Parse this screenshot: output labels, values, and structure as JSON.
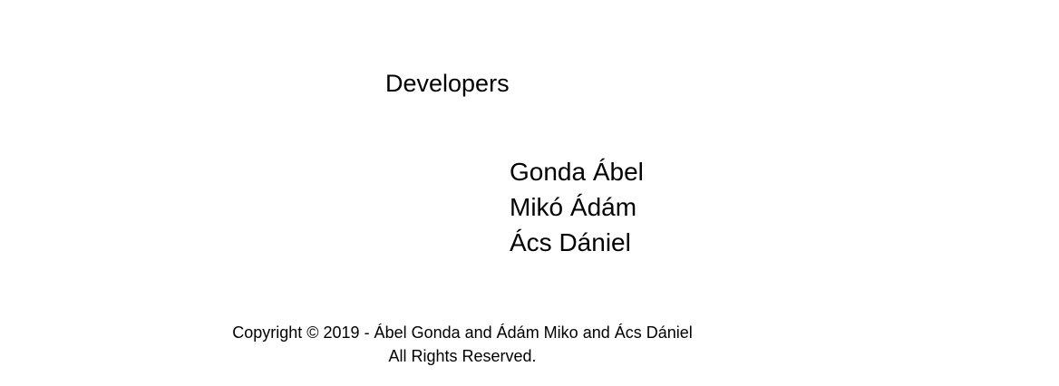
{
  "page": {
    "heading": "Developers",
    "developers": [
      "Gonda Ábel",
      "Mikó Ádám",
      "Ács Dániel"
    ]
  },
  "footer": {
    "copyright": "Copyright © 2019 - Ábel Gonda and Ádám Miko and Ács Dániel",
    "rights": "All Rights Reserved."
  }
}
